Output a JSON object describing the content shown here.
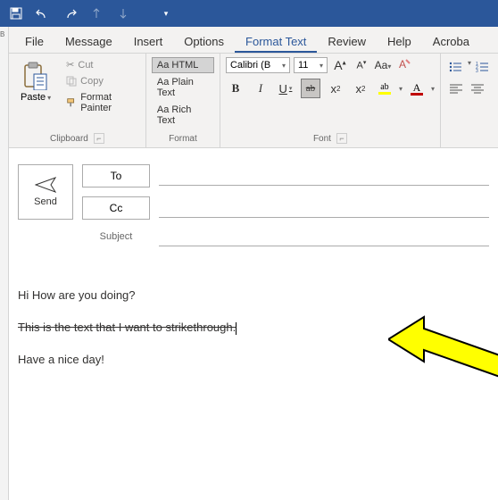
{
  "tabs": {
    "file": "File",
    "message": "Message",
    "insert": "Insert",
    "options": "Options",
    "format_text": "Format Text",
    "review": "Review",
    "help": "Help",
    "acrobat": "Acroba"
  },
  "clipboard": {
    "paste": "Paste",
    "cut": "Cut",
    "copy": "Copy",
    "format_painter": "Format Painter",
    "group_label": "Clipboard"
  },
  "format": {
    "html": "Aa HTML",
    "plain": "Aa Plain Text",
    "rich": "Aa Rich Text",
    "group_label": "Format"
  },
  "font": {
    "name": "Calibri (B",
    "size": "11",
    "grow": "A",
    "shrink": "A",
    "change_case": "Aa",
    "clear": "A",
    "bold": "B",
    "italic": "I",
    "underline": "U",
    "strike": "ab",
    "sub": "x",
    "sub2": "2",
    "sup": "x",
    "sup2": "2",
    "highlight": "ab",
    "fontcolor": "A",
    "group_label": "Font"
  },
  "compose": {
    "send": "Send",
    "to": "To",
    "cc": "Cc",
    "subject": "Subject"
  },
  "body": {
    "line1": "Hi How are you doing?",
    "line2": "This is the text that I want to strikethrough.",
    "line3": "Have a nice day!"
  }
}
